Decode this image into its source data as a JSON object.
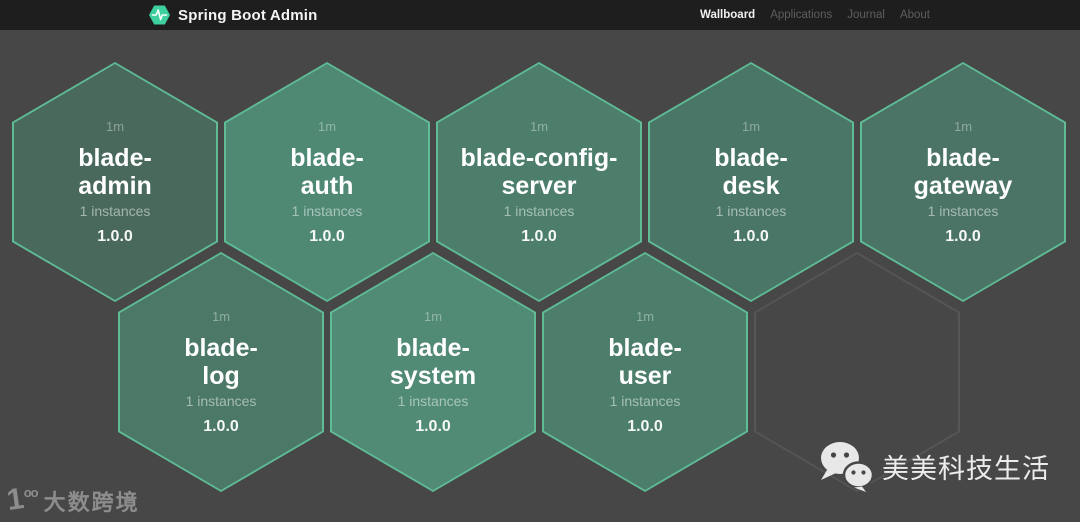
{
  "header": {
    "brand": "Spring Boot Admin",
    "nav": [
      {
        "label": "Wallboard",
        "active": true
      },
      {
        "label": "Applications",
        "active": false
      },
      {
        "label": "Journal",
        "active": false
      },
      {
        "label": "About",
        "active": false
      }
    ]
  },
  "wallboard": {
    "tiles": [
      {
        "name": "blade-admin",
        "name_lines": [
          "blade-",
          "admin"
        ],
        "time": "1m",
        "instances": "1 instances",
        "version": "1.0.0",
        "fill": "#48695c",
        "row": 0,
        "col": 0
      },
      {
        "name": "blade-auth",
        "name_lines": [
          "blade-",
          "auth"
        ],
        "time": "1m",
        "instances": "1 instances",
        "version": "1.0.0",
        "fill": "#4f8974",
        "row": 0,
        "col": 1
      },
      {
        "name": "blade-config-server",
        "name_lines": [
          "blade-config-",
          "server"
        ],
        "time": "1m",
        "instances": "1 instances",
        "version": "1.0.0",
        "fill": "#4c7e6b",
        "row": 0,
        "col": 2
      },
      {
        "name": "blade-desk",
        "name_lines": [
          "blade-",
          "desk"
        ],
        "time": "1m",
        "instances": "1 instances",
        "version": "1.0.0",
        "fill": "#4a7667",
        "row": 0,
        "col": 3
      },
      {
        "name": "blade-gateway",
        "name_lines": [
          "blade-",
          "gateway"
        ],
        "time": "1m",
        "instances": "1 instances",
        "version": "1.0.0",
        "fill": "#4b7467",
        "row": 0,
        "col": 4
      },
      {
        "name": "blade-log",
        "name_lines": [
          "blade-",
          "log"
        ],
        "time": "1m",
        "instances": "1 instances",
        "version": "1.0.0",
        "fill": "#4b7867",
        "row": 1,
        "col": 0
      },
      {
        "name": "blade-system",
        "name_lines": [
          "blade-",
          "system"
        ],
        "time": "1m",
        "instances": "1 instances",
        "version": "1.0.0",
        "fill": "#518a75",
        "row": 1,
        "col": 1
      },
      {
        "name": "blade-user",
        "name_lines": [
          "blade-",
          "user"
        ],
        "time": "1m",
        "instances": "1 instances",
        "version": "1.0.0",
        "fill": "#4c7e6b",
        "row": 1,
        "col": 2
      }
    ],
    "empty_tile": {
      "row": 1,
      "col": 3
    }
  },
  "watermarks": {
    "bottom_left_logo": "1oo",
    "bottom_left": "大数跨境",
    "bottom_right": "美美科技生活"
  },
  "colors": {
    "header_bg": "#1e1e1e",
    "page_bg": "#474747",
    "tile_border": "#5fbd96",
    "empty_tile_border": "#565656",
    "logo_green": "#3ecf9e",
    "nav_active": "#f0f0f0",
    "nav_inactive": "#5e5e5e"
  }
}
